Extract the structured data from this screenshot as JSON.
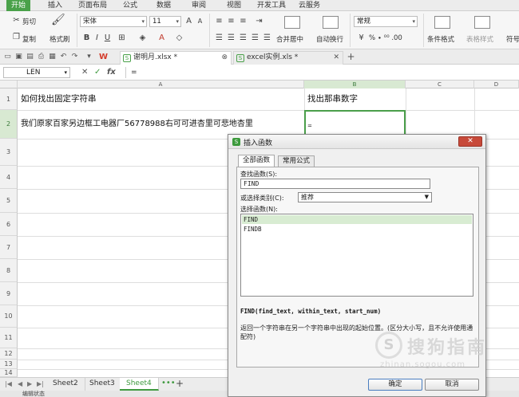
{
  "ribbon_tabs": [
    "开始",
    "插入",
    "页面布局",
    "公式",
    "数据",
    "审阅",
    "视图",
    "开发工具",
    "云服务"
  ],
  "ribbon": {
    "cut": "剪切",
    "copy": "复制",
    "format_painter": "格式刷",
    "font_name": "宋体",
    "font_size": "11",
    "merge_center": "合并居中",
    "wrap_text": "自动换行",
    "number_format": "常规",
    "percent_group": "% ∙ ⁰⁰ .00",
    "conditional_format": "条件格式",
    "table_style": "表格样式",
    "symbol": "符号"
  },
  "doc_tabs": [
    {
      "name": "谢明月.xlsx *",
      "active": true
    },
    {
      "name": "excel实例.xls *",
      "active": false
    }
  ],
  "formula_bar": {
    "name_box": "LEN",
    "fx": "fx",
    "content": "="
  },
  "columns": [
    "A",
    "B",
    "C",
    "D"
  ],
  "rows": [
    "1",
    "2",
    "3",
    "4",
    "5",
    "6",
    "7",
    "8",
    "9",
    "10",
    "11",
    "12",
    "13",
    "14"
  ],
  "cells": {
    "A1": "如何找出固定字符串",
    "B1": "找出那串数字",
    "A2": "我们原家百家另边框工电器厂56778988右可可进杏里可悲地杏里",
    "B2": "="
  },
  "sheet_tabs": [
    "Sheet2",
    "Sheet3",
    "Sheet4"
  ],
  "active_sheet": "Sheet4",
  "status_text": "编辑状态",
  "dialog": {
    "title": "插入函数",
    "tabs": [
      "全部函数",
      "常用公式"
    ],
    "search_label": "查找函数(S):",
    "search_value": "FIND",
    "category_label": "或选择类别(C):",
    "category_value": "推荐",
    "list_label": "选择函数(N):",
    "functions": [
      "FIND",
      "FINDB"
    ],
    "selected_function": "FIND",
    "syntax": "FIND(find_text, within_text, start_num)",
    "description": "返回一个字符串在另一个字符串中出现的起始位置。(区分大小写，且不允许使用通配符)",
    "ok": "确定",
    "cancel": "取消"
  },
  "watermark": {
    "logo": "S",
    "text": "搜狗指南",
    "url": "zhinan.sogou.com"
  },
  "colors": {
    "accent": "#4aa14a",
    "close": "#c74a3a"
  }
}
